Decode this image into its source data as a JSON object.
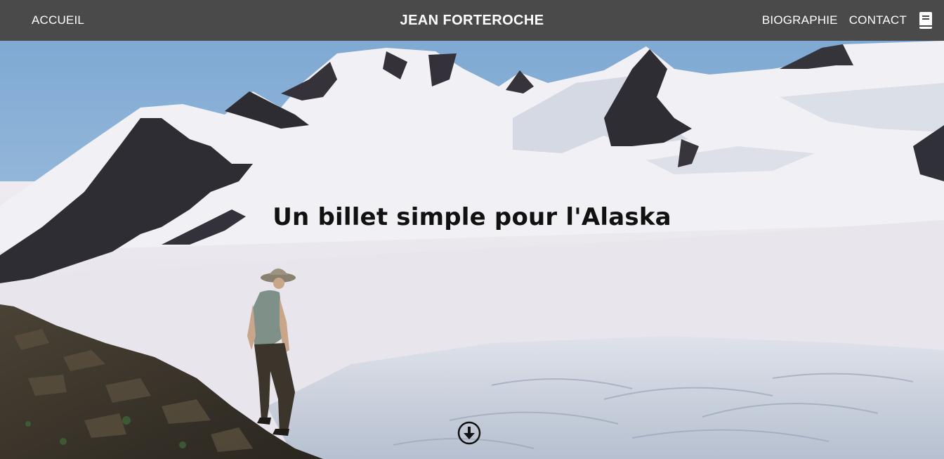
{
  "nav": {
    "home_label": "ACCUEIL",
    "brand": "JEAN FORTEROCHE",
    "biography_label": "BIOGRAPHIE",
    "contact_label": "CONTACT",
    "book_icon": "book-icon"
  },
  "hero": {
    "title": "Un billet simple pour l'Alaska",
    "scroll_icon": "arrow-down-circle-icon"
  },
  "colors": {
    "navbar": "#4a4a4a",
    "nav_text": "#ffffff",
    "sky": "#8fb6d9",
    "snow": "#eeedf2",
    "rock": "#2f2d33"
  }
}
